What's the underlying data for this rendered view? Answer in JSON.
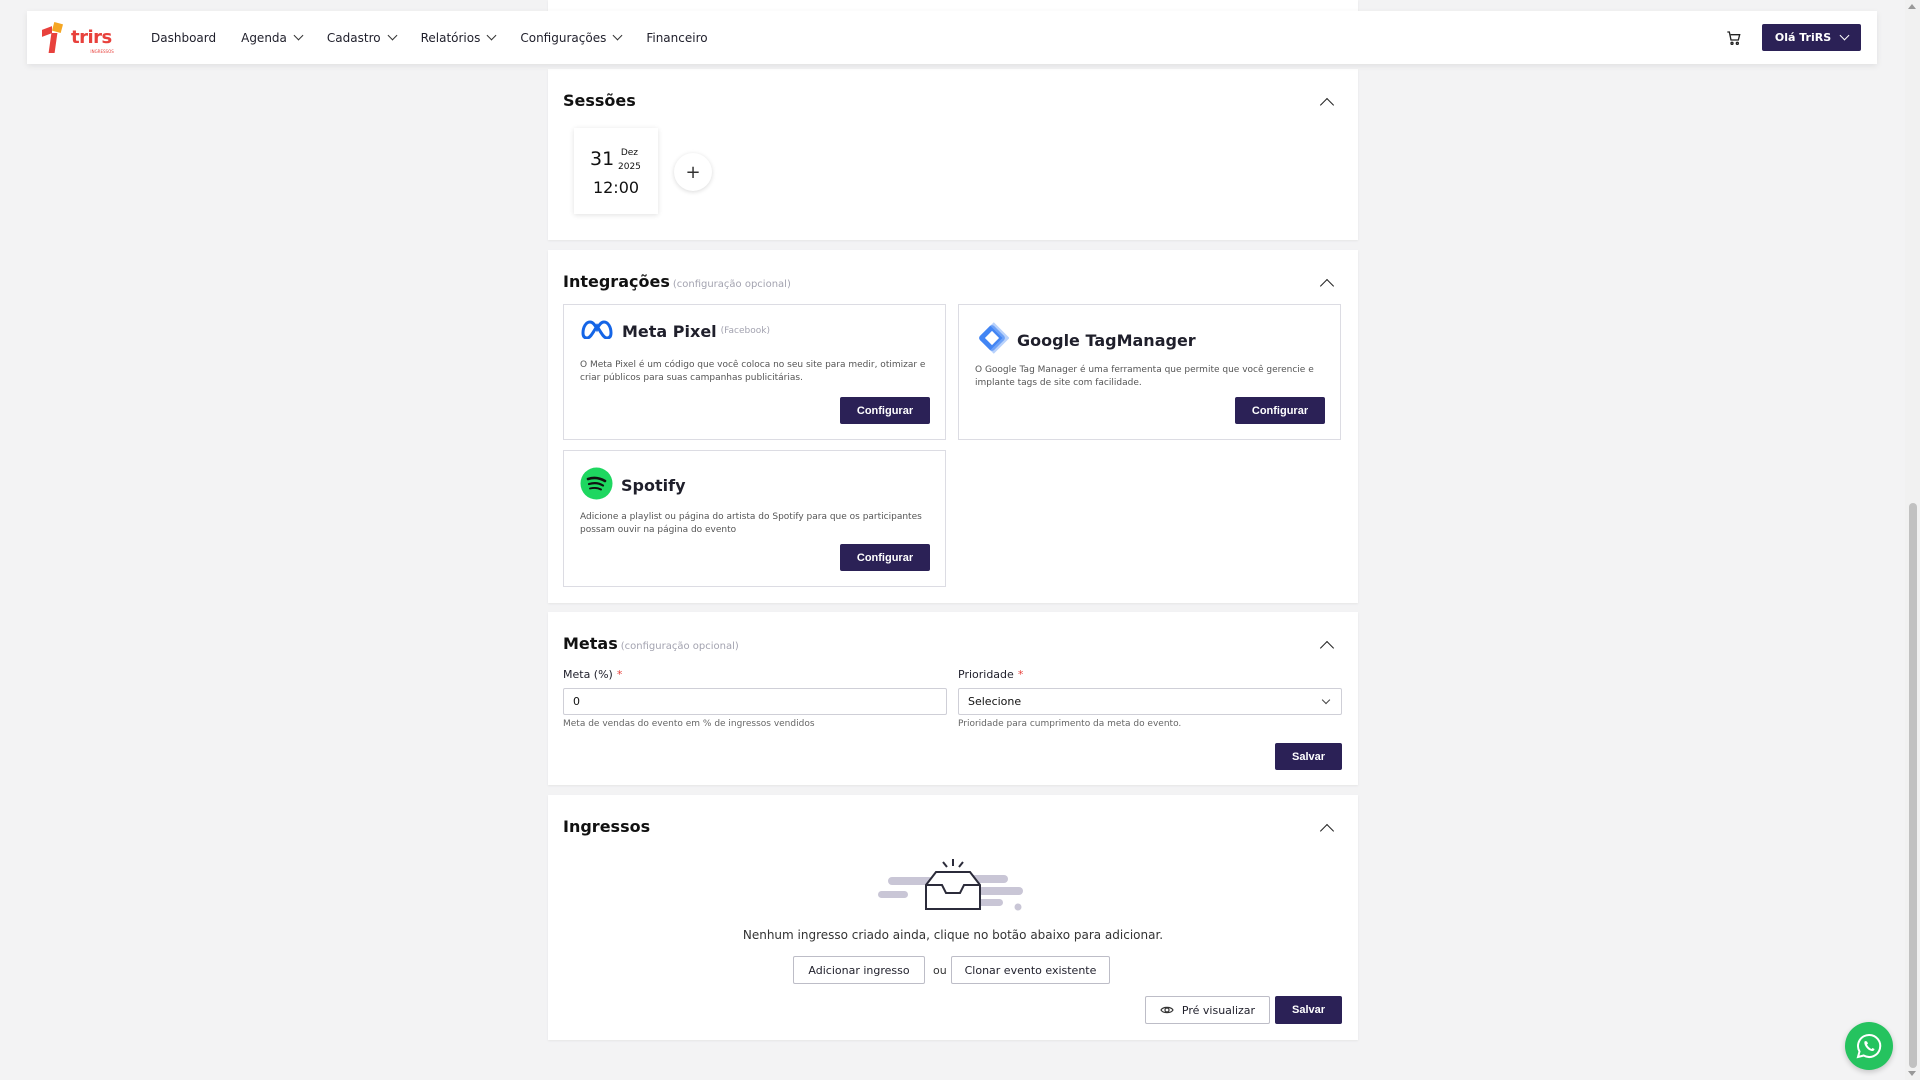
{
  "nav": {
    "brand": "trirs",
    "brand_sub": "INGRESSOS",
    "items": [
      {
        "label": "Dashboard",
        "has_dropdown": false
      },
      {
        "label": "Agenda",
        "has_dropdown": true
      },
      {
        "label": "Cadastro",
        "has_dropdown": true
      },
      {
        "label": "Relatórios",
        "has_dropdown": true
      },
      {
        "label": "Configurações",
        "has_dropdown": true
      },
      {
        "label": "Financeiro",
        "has_dropdown": false
      }
    ],
    "cart_icon": "cart-icon",
    "user_label": "Olá TriRS"
  },
  "sessions": {
    "title": "Sessões",
    "items": [
      {
        "day": "31",
        "month": "Dez",
        "year": "2025",
        "time": "12:00"
      }
    ],
    "add_label": "+"
  },
  "integrations": {
    "title": "Integrações",
    "optional": "(configuração opcional)",
    "items": [
      {
        "name": "Meta Pixel",
        "sub": "(Facebook)",
        "description": "O Meta Pixel é um código que você coloca no seu site para medir, otimizar e criar públicos para suas campanhas publicitárias.",
        "button": "Configurar"
      },
      {
        "name": "Google TagManager",
        "sub": "",
        "description": "O Google Tag Manager é uma ferramenta que permite que você gerencie e implante tags de site com facilidade.",
        "button": "Configurar"
      },
      {
        "name": "Spotify",
        "sub": "",
        "description": "Adicione a playlist ou página do artista do Spotify para que os participantes possam ouvir na página do evento",
        "button": "Configurar"
      }
    ]
  },
  "metas": {
    "title": "Metas",
    "optional": "(configuração opcional)",
    "meta_label": "Meta (%)",
    "meta_value": "0",
    "meta_help": "Meta de vendas do evento em % de ingressos vendidos",
    "prioridade_label": "Prioridade",
    "prioridade_value": "Selecione",
    "prioridade_help": "Prioridade para cumprimento da meta do evento.",
    "required_mark": "*",
    "save": "Salvar"
  },
  "ingressos": {
    "title": "Ingressos",
    "empty_text": "Nenhum ingresso criado ainda, clique no botão abaixo para adicionar.",
    "add_button": "Adicionar ingresso",
    "or": "ou",
    "clone_button": "Clonar evento existente",
    "preview_button": "Pré visualizar",
    "save": "Salvar"
  },
  "colors": {
    "primary": "#2b2156",
    "brand": "#e8413c",
    "whatsapp": "#25c35f"
  }
}
